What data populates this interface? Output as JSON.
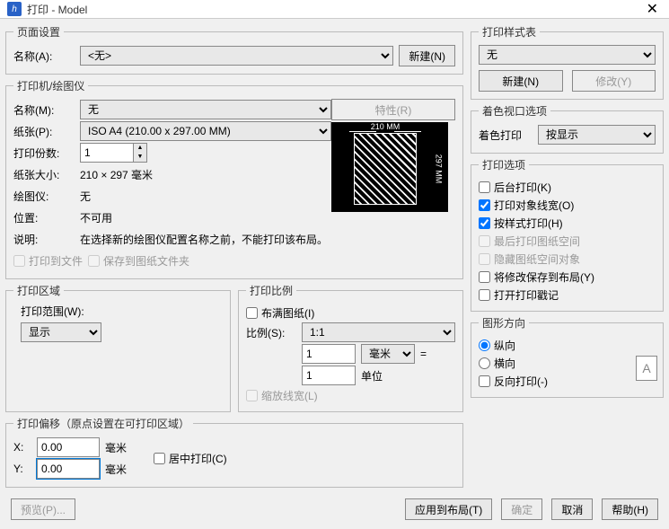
{
  "window": {
    "title": "打印 - Model"
  },
  "page_setup": {
    "legend": "页面设置",
    "name_label": "名称(A):",
    "name_value": "<无>",
    "new_btn": "新建(N)"
  },
  "printer": {
    "legend": "打印机/绘图仪",
    "name_label": "名称(M):",
    "name_value": "无",
    "props_btn": "特性(R)",
    "paper_label": "纸张(P):",
    "paper_value": "ISO A4 (210.00 x 297.00 MM)",
    "copies_label": "打印份数:",
    "copies_value": "1",
    "size_label": "纸张大小:",
    "size_value": "210 × 297  毫米",
    "plotter_label": "绘图仪:",
    "plotter_value": "无",
    "location_label": "位置:",
    "location_value": "不可用",
    "desc_label": "说明:",
    "desc_value": "在选择新的绘图仪配置名称之前，不能打印该布局。",
    "print_to_file": "打印到文件",
    "save_to_paper": "保存到图纸文件夹",
    "preview_top": "210 MM",
    "preview_right": "297 MM"
  },
  "area": {
    "legend": "打印区域",
    "range_label": "打印范围(W):",
    "range_value": "显示"
  },
  "scale": {
    "legend": "打印比例",
    "fit_label": "布满图纸(I)",
    "scale_label": "比例(S):",
    "scale_value": "1:1",
    "num1": "1",
    "unit1": "毫米",
    "eq": "=",
    "num2": "1",
    "unit2": "单位",
    "scale_lw": "缩放线宽(L)"
  },
  "offset": {
    "legend": "打印偏移（原点设置在可打印区域）",
    "x_label": "X:",
    "x_value": "0.00",
    "y_label": "Y:",
    "y_value": "0.00",
    "mm": "毫米",
    "center": "居中打印(C)"
  },
  "style": {
    "legend": "打印样式表",
    "value": "无",
    "new_btn": "新建(N)",
    "mod_btn": "修改(Y)"
  },
  "shade": {
    "legend": "着色视口选项",
    "label": "着色打印",
    "value": "按显示"
  },
  "options": {
    "legend": "打印选项",
    "bg": "后台打印(K)",
    "lw": "打印对象线宽(O)",
    "bystyle": "按样式打印(H)",
    "last_space": "最后打印图纸空间",
    "hide_space": "隐藏图纸空间对象",
    "save_layout": "将修改保存到布局(Y)",
    "open_stamp": "打开打印戳记"
  },
  "orient": {
    "legend": "图形方向",
    "portrait": "纵向",
    "landscape": "横向",
    "reverse": "反向打印(-)",
    "icon": "A"
  },
  "buttons": {
    "preview": "预览(P)...",
    "apply": "应用到布局(T)",
    "ok": "确定",
    "cancel": "取消",
    "help": "帮助(H)"
  }
}
